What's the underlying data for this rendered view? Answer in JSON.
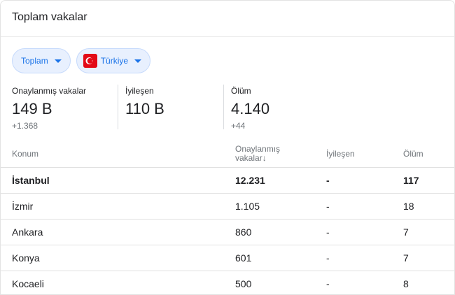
{
  "header": {
    "title": "Toplam vakalar"
  },
  "filters": {
    "type_label": "Toplam",
    "country_label": "Türkiye",
    "flag_color": "#e30a17"
  },
  "stats": [
    {
      "label": "Onaylanmış vakalar",
      "value": "149 B",
      "delta": "+1.368"
    },
    {
      "label": "İyileşen",
      "value": "110 B",
      "delta": ""
    },
    {
      "label": "Ölüm",
      "value": "4.140",
      "delta": "+44"
    }
  ],
  "table": {
    "headers": {
      "location": "Konum",
      "confirmed_line1": "Onaylanmış",
      "confirmed_line2": "vakalar",
      "sort_arrow": "↓",
      "recovered": "İyileşen",
      "deaths": "Ölüm"
    },
    "rows": [
      {
        "location": "İstanbul",
        "confirmed": "12.231",
        "recovered": "-",
        "deaths": "117"
      },
      {
        "location": "İzmir",
        "confirmed": "1.105",
        "recovered": "-",
        "deaths": "18"
      },
      {
        "location": "Ankara",
        "confirmed": "860",
        "recovered": "-",
        "deaths": "7"
      },
      {
        "location": "Konya",
        "confirmed": "601",
        "recovered": "-",
        "deaths": "7"
      },
      {
        "location": "Kocaeli",
        "confirmed": "500",
        "recovered": "-",
        "deaths": "8"
      }
    ]
  }
}
